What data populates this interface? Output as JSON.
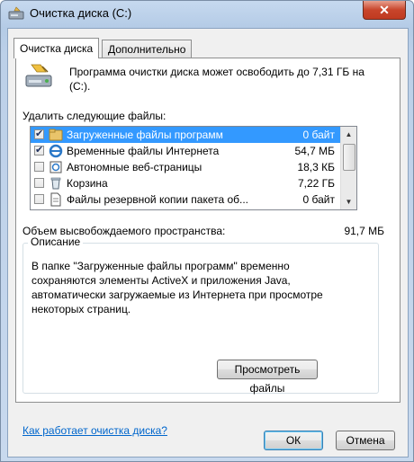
{
  "window": {
    "title": "Очистка диска  (C:)",
    "close_symbol": "✕"
  },
  "tabs": [
    {
      "label": "Очистка диска",
      "active": true
    },
    {
      "label": "Дополнительно",
      "active": false
    }
  ],
  "info": {
    "text": "Программа очистки диска может освободить до 7,31 ГБ на  (C:).",
    "icon": "drive-cleanup-icon"
  },
  "files": {
    "label": "Удалить следующие файлы:",
    "items": [
      {
        "name": "Загруженные файлы программ",
        "size": "0 байт",
        "checked": true,
        "selected": true,
        "icon": "folder-icon"
      },
      {
        "name": "Временные файлы Интернета",
        "size": "54,7 МБ",
        "checked": true,
        "selected": false,
        "icon": "ie-icon"
      },
      {
        "name": "Автономные веб-страницы",
        "size": "18,3 КБ",
        "checked": false,
        "selected": false,
        "icon": "offline-page-icon"
      },
      {
        "name": "Корзина",
        "size": "7,22 ГБ",
        "checked": false,
        "selected": false,
        "icon": "recycle-bin-icon"
      },
      {
        "name": "Файлы резервной копии пакета об...",
        "size": "0 байт",
        "checked": false,
        "selected": false,
        "icon": "document-icon"
      }
    ]
  },
  "space": {
    "label": "Объем высвобождаемого пространства:",
    "value": "91,7 МБ"
  },
  "description": {
    "title": "Описание",
    "text": "В папке \"Загруженные файлы программ\" временно сохраняются элементы ActiveX и приложения Java, автоматически загружаемые из Интернета при просмотре некоторых страниц.",
    "view_button": "Просмотреть файлы"
  },
  "help_link": "Как работает очистка диска?",
  "buttons": {
    "ok": "ОК",
    "cancel": "Отмена"
  },
  "colors": {
    "selection": "#3399ff",
    "link": "#0066cc",
    "close_button": "#c8452b"
  }
}
